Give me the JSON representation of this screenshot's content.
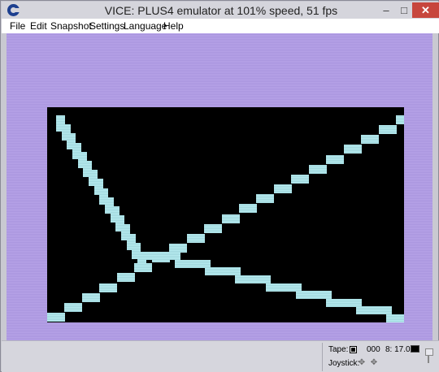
{
  "window": {
    "title": "VICE: PLUS4 emulator at 101% speed, 51 fps",
    "controls": {
      "minimize": "–",
      "maximize": "□",
      "close": "✕"
    }
  },
  "menu": [
    {
      "label": "File"
    },
    {
      "label": "Edit"
    },
    {
      "label": "Snapshot"
    },
    {
      "label": "Settings"
    },
    {
      "label": "Language"
    },
    {
      "label": "Help"
    }
  ],
  "screen": {
    "border_color": "#b7a3e8",
    "background_color": "#000000",
    "line_color": "#b8ecf0",
    "text_columns": 40,
    "text_rows": 25
  },
  "status": {
    "tape_label": "Tape:",
    "tape_counter": "000",
    "drive_label": "8: 17.0",
    "joystick_label": "Joystick:"
  }
}
